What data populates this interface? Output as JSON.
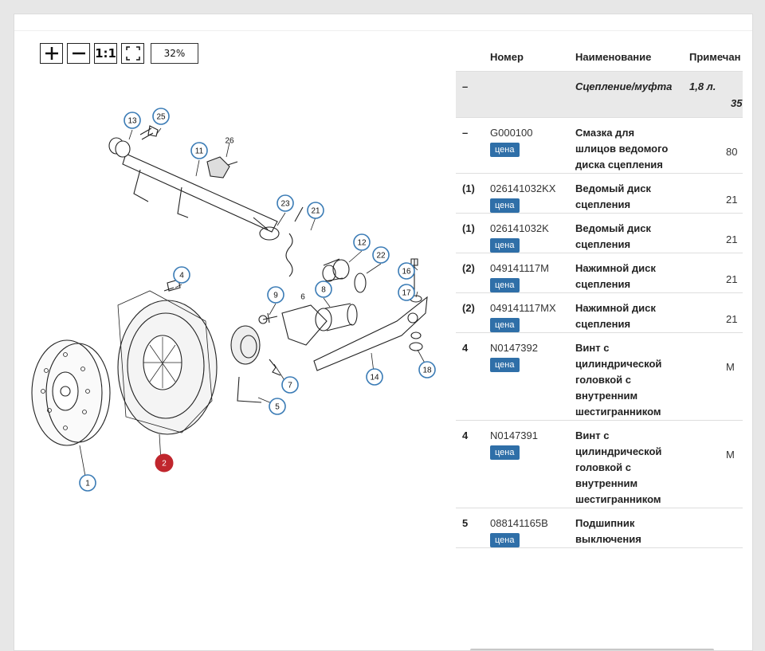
{
  "toolbar": {
    "zoom_in_label": "+",
    "zoom_out_label": "−",
    "actual_size_label": "1:1",
    "fit_icon": "fit-to-screen-icon",
    "zoom_value": "32%"
  },
  "diagram": {
    "callouts": [
      "13",
      "25",
      "11",
      "26",
      "23",
      "21",
      "12",
      "22",
      "16",
      "17",
      "4",
      "9",
      "6",
      "8",
      "18",
      "14",
      "7",
      "5",
      "1",
      "2"
    ],
    "plain_labels": [
      "26",
      "6",
      "17"
    ],
    "selected_callout": "2",
    "callout_color": "#3a7bb5",
    "selected_color": "#c0262d"
  },
  "table": {
    "headers": [
      "",
      "Номер",
      "Наименование",
      "Примечан"
    ],
    "group_row": {
      "qty": "–",
      "name": "Сцепление/муфта",
      "note": "1,8 л.",
      "note2": "35"
    },
    "rows": [
      {
        "qty": "–",
        "number": "G000100",
        "badge": "цена",
        "name_lines": [
          "Смазка для",
          "шлицов ведомого",
          "диска сцепления"
        ],
        "note": "80"
      },
      {
        "qty": "(1)",
        "number": "026141032KX",
        "badge": "цена",
        "name_lines": [
          "Ведомый диск",
          "сцепления"
        ],
        "note": "21"
      },
      {
        "qty": "(1)",
        "number": "026141032K",
        "badge": "цена",
        "name_lines": [
          "Ведомый диск",
          "сцепления"
        ],
        "note": "21"
      },
      {
        "qty": "(2)",
        "number": "049141117M",
        "badge": "цена",
        "name_lines": [
          "Нажимной диск",
          "сцепления"
        ],
        "note": "21"
      },
      {
        "qty": "(2)",
        "number": "049141117MX",
        "badge": "цена",
        "name_lines": [
          "Нажимной диск",
          "сцепления"
        ],
        "note": "21"
      },
      {
        "qty": "4",
        "number": "N0147392",
        "badge": "цена",
        "name_lines": [
          "Винт с",
          "цилиндрической",
          "головкой с",
          "внутренним",
          "шестигранником"
        ],
        "note": "М"
      },
      {
        "qty": "4",
        "number": "N0147391",
        "badge": "цена",
        "name_lines": [
          "Винт с",
          "цилиндрической",
          "головкой с",
          "внутренним",
          "шестигранником"
        ],
        "note": "М"
      },
      {
        "qty": "5",
        "number": "088141165B",
        "badge": "цена",
        "name_lines": [
          "Подшипник",
          "выключения"
        ],
        "note": ""
      }
    ]
  },
  "colors": {
    "badge": "#2f6fa8",
    "group_bg": "#e9e9e9"
  }
}
